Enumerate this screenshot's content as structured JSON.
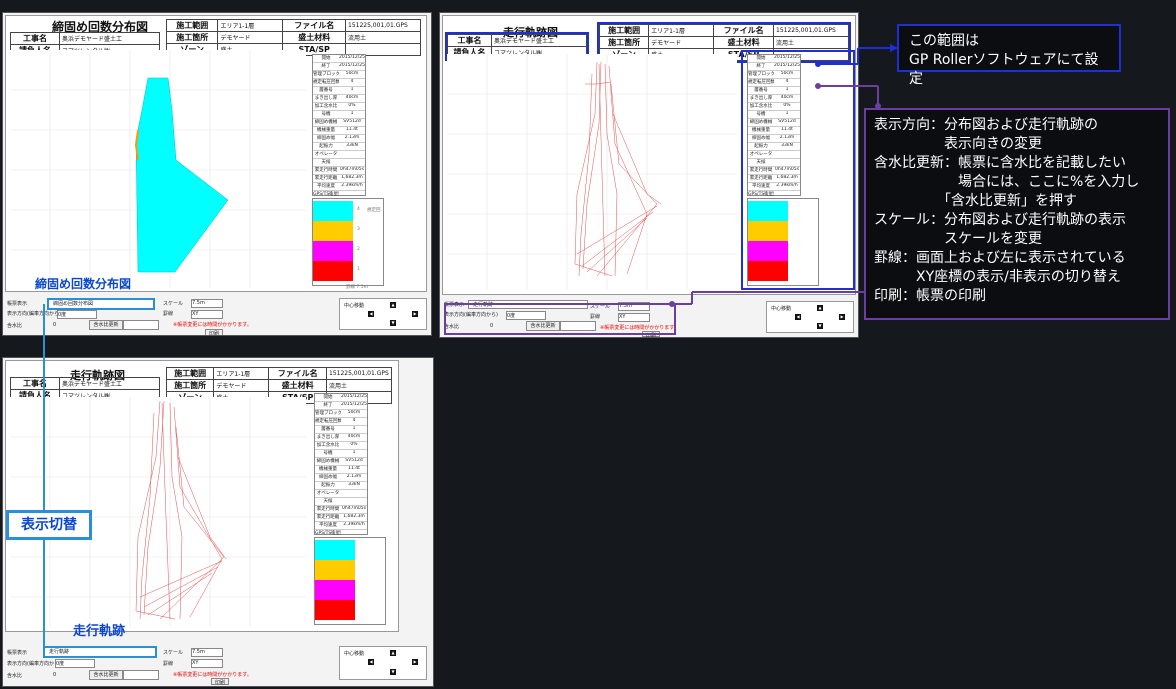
{
  "header_common": {
    "survey_range_label": "施工範囲",
    "survey_range_value": "エリア1-1層",
    "location_label": "施工箇所",
    "location_value": "デモヤード",
    "file_label": "ファイル名",
    "file_value": "151225,001,01.GPS",
    "material_label": "盛土材料",
    "material_value": "流用土",
    "project_label": "工事名",
    "project_value": "奥浜デモヤード盛土工",
    "contractor_label": "請負人名",
    "contractor_value": "コマツレンタル㈱",
    "zone_label": "ゾーン",
    "zone_value": "盛土",
    "sta_label": "STA/SP"
  },
  "shot1": {
    "title": "締固め回数分布図",
    "caption": "締固め回数分布図",
    "display_label": "帳票表示",
    "display_value": "締固め回数分布図"
  },
  "shot2": {
    "title": "走行軌跡図",
    "display_label": "帳票表示",
    "display_value": "走行軌跡"
  },
  "shot3": {
    "title": "走行軌跡図",
    "caption": "走行軌跡",
    "display_label": "帳票表示",
    "display_value": "走行軌跡"
  },
  "controls": {
    "direction_label": "表示方向(編車方向から)",
    "direction_value": "0度",
    "moisture_label": "含水比",
    "moisture_value": "0",
    "moisture_update_button": "含水比更新",
    "scale_label": "スケール",
    "scale_value": "7.5m",
    "grid_label": "罫線",
    "grid_value": "XY",
    "warning": "※帳票変更には時間がかかります。",
    "print_button": "印刷",
    "center_move_label": "中心移動"
  },
  "info_rows": [
    [
      "開始",
      "2015/12/25 12:14:53"
    ],
    [
      "終了",
      "2015/12/25 16:17:57"
    ],
    [
      "管理ブロックサイズ",
      "50cm"
    ],
    [
      "規定転圧回数",
      "4"
    ],
    [
      "層番号",
      "1"
    ],
    [
      "まき出し厚",
      "40cm"
    ],
    [
      "加工含水比",
      "0%"
    ],
    [
      "号機",
      "1"
    ],
    [
      "締固め機械",
      "SV512d"
    ],
    [
      "機械重量",
      "11.4t"
    ],
    [
      "締固め幅",
      "2.13m"
    ],
    [
      "起振力",
      "33kN"
    ],
    [
      "オペレータ",
      ""
    ],
    [
      "天候",
      ""
    ],
    [
      "累走行時間",
      "0h47m05s"
    ],
    [
      "累走行距離",
      "1,682.3m"
    ],
    [
      "平均速度",
      "2.39km/h"
    ],
    [
      "GPS/TS衛星数",
      ""
    ],
    [
      "衛星数",
      "13~16"
    ],
    [
      "HDOP",
      "0.65~0.94"
    ]
  ],
  "legend": {
    "colors": [
      "#00ffff",
      "#ffcc00",
      "#ff00ff",
      "#ff0000"
    ],
    "labels": [
      "4",
      "3",
      "2",
      "1"
    ],
    "top_label": "規定回",
    "scale_text": "罫線 7.5m"
  },
  "ticks_x": [
    "Y: 22,850.0",
    "Y: 22,842.5",
    "Y: 22,835.0",
    "Y: 22,827.5",
    "Y: 22,820.0",
    "Y: 22,812.5",
    "Y: 22,805.0"
  ],
  "ticks_y": [
    "X: -14,050.0",
    "X: -42,857.5",
    "X: -42,865.0",
    "X: -42,872.5",
    "X: -42,880.0"
  ],
  "badge": "表示切替",
  "note_top": {
    "line1": "この範囲は",
    "line2": "GP Rollerソフトウェアにて設定"
  },
  "note_main": [
    "表示方向：分布図および走行軌跡の",
    "　　　　　表示向きの変更",
    "含水比更新：帳票に含水比を記載したい",
    "　　　　　　場合には、ここに%を入力し",
    "　　　　　「含水比更新」を押す",
    "スケール：分布図および走行軌跡の表示",
    "　　　　　スケールを変更",
    "罫線：画面上および左に表示されている",
    "　　　XY座標の表示/非表示の切り替え",
    "印刷：帳票の印刷"
  ],
  "colors": {
    "accent_blue": "#1f2fd6",
    "accent_purple": "#6b3fa0",
    "cyan_box": "#2a8fd6",
    "caption_blue": "#0a46d0"
  }
}
